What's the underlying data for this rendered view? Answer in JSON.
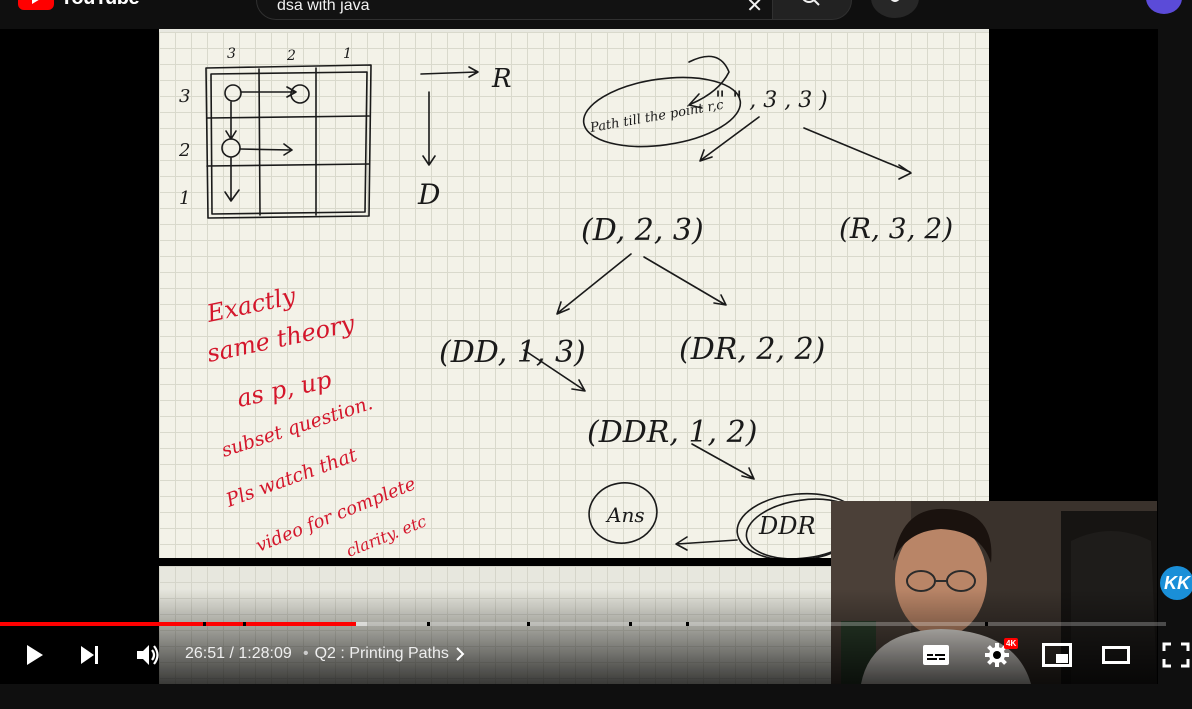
{
  "header": {
    "logo_text": "YouTube",
    "search_value": "dsa with java"
  },
  "player": {
    "current_time": "26:51",
    "separator": "/",
    "duration": "1:28:09",
    "chapter_bullet": "•",
    "chapter_title": "Q2 : Printing Paths",
    "quality_badge": "4K",
    "progress_fraction": 0.305,
    "channel_badge": "KK"
  },
  "slide": {
    "grid_labels_top": [
      "3",
      "2",
      "1"
    ],
    "grid_labels_left": [
      "3",
      "2",
      "1"
    ],
    "legend_right": "R",
    "legend_down": "D",
    "root_args": "\" \"   ,   3 , 3 )",
    "note_path": "Path till the point r,c",
    "node_d": "(D, 2, 3)",
    "node_r": "(R, 3, 2)",
    "node_dd": "(DD, 1, 3)",
    "node_dr": "(DR, 2, 2)",
    "node_ddr": "(DDR, 1, 2)",
    "node_ans": "Ans",
    "node_ddr2": "DDR",
    "red_note": [
      "Exactly",
      "same theory",
      "as p, up",
      "subset question.",
      "Pls watch that",
      "video for complete",
      "clarity. etc"
    ]
  },
  "colors": {
    "accent": "#ff0000",
    "ink": "#1a1a1a",
    "red_ink": "#d4162b",
    "background": "#0f0f0f"
  }
}
